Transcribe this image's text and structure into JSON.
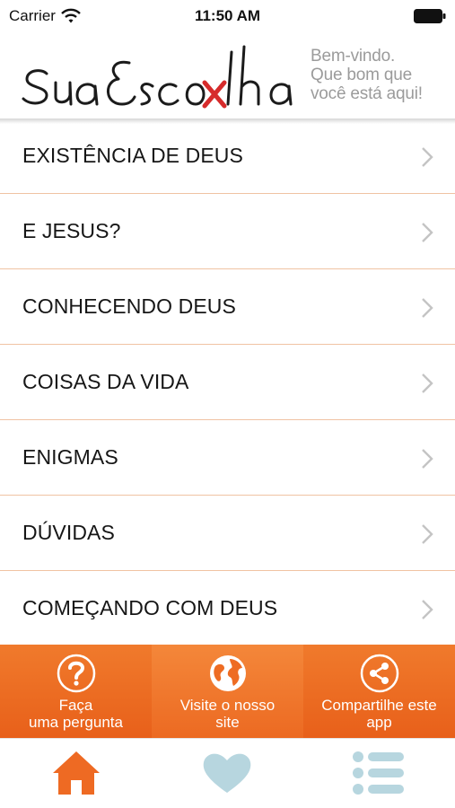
{
  "status_bar": {
    "carrier": "Carrier",
    "time": "11:50 AM"
  },
  "header": {
    "logo_text": "SuaEscolha",
    "welcome_lines": [
      "Bem-vindo.",
      "Que bom que",
      "você está aqui!"
    ]
  },
  "menu": {
    "items": [
      {
        "label": "EXISTÊNCIA DE DEUS"
      },
      {
        "label": "E JESUS?"
      },
      {
        "label": "CONHECENDO DEUS"
      },
      {
        "label": "COISAS DA VIDA"
      },
      {
        "label": "ENIGMAS"
      },
      {
        "label": "DÚVIDAS"
      },
      {
        "label": "COMEÇANDO COM DEUS"
      }
    ],
    "chevron_icon": "chevron-right-icon"
  },
  "actions": [
    {
      "icon": "question-icon",
      "line1": "Faça",
      "line2": "uma pergunta"
    },
    {
      "icon": "globe-icon",
      "line1": "Visite o nosso",
      "line2": "site"
    },
    {
      "icon": "share-icon",
      "line1": "Compartilhe este",
      "line2": "app"
    }
  ],
  "tabs": [
    {
      "icon": "home-icon",
      "active": true
    },
    {
      "icon": "heart-icon",
      "active": false
    },
    {
      "icon": "list-icon",
      "active": false
    }
  ],
  "colors": {
    "accent": "#ee6c23",
    "divider": "#f0c3a3",
    "tab_active": "#ee6a23",
    "tab_inactive": "#b7d6df",
    "welcome_text": "#9b9b9b"
  }
}
